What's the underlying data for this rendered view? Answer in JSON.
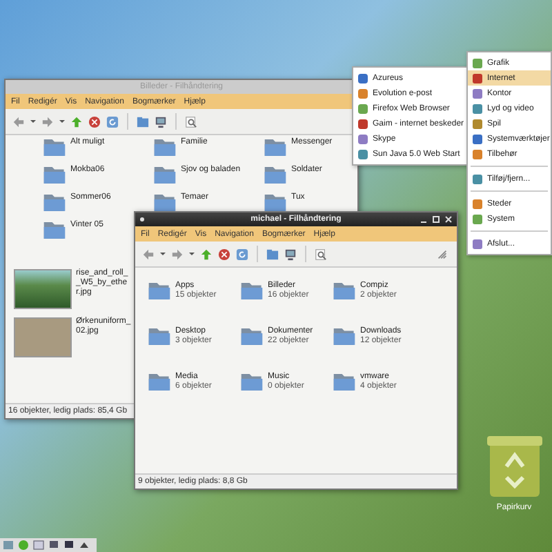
{
  "windows": [
    {
      "title": "Billeder - Filhåndtering",
      "active": false,
      "menu": [
        "Fil",
        "Redigér",
        "Vis",
        "Navigation",
        "Bogmærker",
        "Hjælp"
      ],
      "folders": [
        {
          "name": "Alt muligt"
        },
        {
          "name": "Familie"
        },
        {
          "name": "Messenger"
        },
        {
          "name": "Mokba06"
        },
        {
          "name": "Sjov og baladen"
        },
        {
          "name": "Soldater"
        },
        {
          "name": "Sommer06"
        },
        {
          "name": "Temaer"
        },
        {
          "name": "Tux"
        },
        {
          "name": "Vinter 05"
        }
      ],
      "files": [
        {
          "name": "rise_and_roll__W5_by_ether.jpg"
        },
        {
          "name": "Ørkenuniform_02.jpg"
        }
      ],
      "status": "16 objekter, ledig plads: 85,4 Gb"
    },
    {
      "title": "michael - Filhåndtering",
      "active": true,
      "menu": [
        "Fil",
        "Redigér",
        "Vis",
        "Navigation",
        "Bogmærker",
        "Hjælp"
      ],
      "folders": [
        {
          "name": "Apps",
          "count": "15 objekter"
        },
        {
          "name": "Billeder",
          "count": "16 objekter"
        },
        {
          "name": "Compiz",
          "count": "2 objekter"
        },
        {
          "name": "Desktop",
          "count": "3 objekter"
        },
        {
          "name": "Dokumenter",
          "count": "22 objekter"
        },
        {
          "name": "Downloads",
          "count": "12 objekter"
        },
        {
          "name": "Media",
          "count": "6 objekter"
        },
        {
          "name": "Music",
          "count": "0 objekter"
        },
        {
          "name": "vmware",
          "count": "4 objekter"
        }
      ],
      "status": "9 objekter, ledig plads: 8,8 Gb"
    }
  ],
  "submenu": {
    "items": [
      "Azureus",
      "Evolution e-post",
      "Firefox Web Browser",
      "Gaim - internet beskeder",
      "Skype",
      "Sun Java 5.0 Web Start"
    ]
  },
  "menu": {
    "groups": [
      [
        {
          "label": "Grafik",
          "selected": false
        },
        {
          "label": "Internet",
          "selected": true
        },
        {
          "label": "Kontor",
          "selected": false
        },
        {
          "label": "Lyd og video",
          "selected": false
        },
        {
          "label": "Spil",
          "selected": false
        },
        {
          "label": "Systemværktøjer",
          "selected": false
        },
        {
          "label": "Tilbehør",
          "selected": false
        }
      ],
      [
        {
          "label": "Tilføj/fjern...",
          "selected": false
        }
      ],
      [
        {
          "label": "Steder",
          "selected": false
        },
        {
          "label": "System",
          "selected": false
        }
      ],
      [
        {
          "label": "Afslut...",
          "selected": false
        }
      ]
    ]
  },
  "trash": {
    "label": "Papirkurv"
  }
}
